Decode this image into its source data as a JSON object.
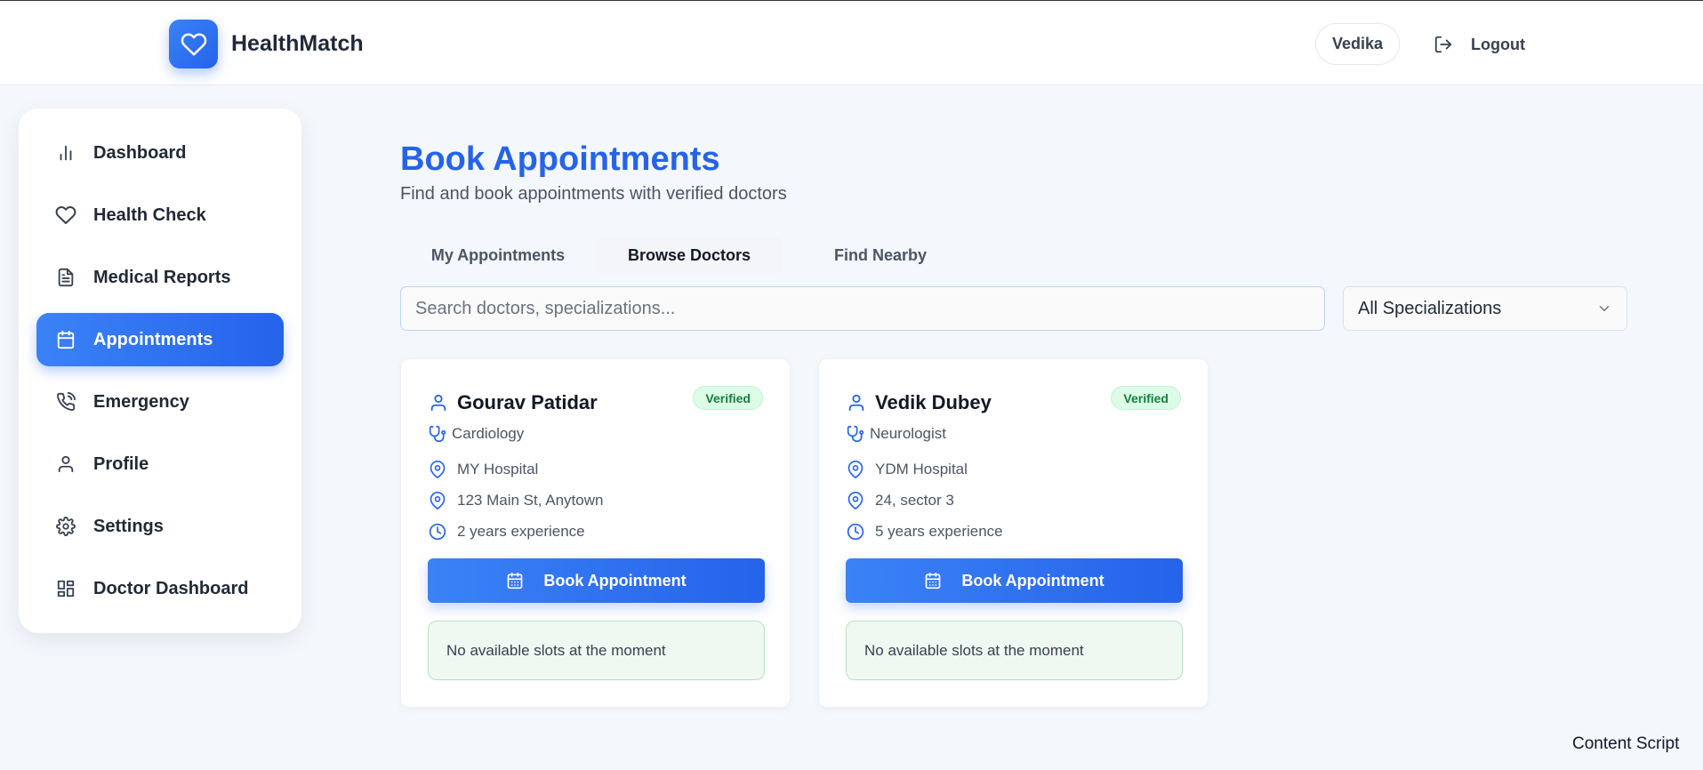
{
  "header": {
    "brand": "HealthMatch",
    "user_name": "Vedika",
    "logout_label": "Logout"
  },
  "sidebar": {
    "items": [
      {
        "label": "Dashboard",
        "icon": "bar-chart-icon"
      },
      {
        "label": "Health Check",
        "icon": "heart-icon"
      },
      {
        "label": "Medical Reports",
        "icon": "file-text-icon"
      },
      {
        "label": "Appointments",
        "icon": "calendar-icon",
        "active": true
      },
      {
        "label": "Emergency",
        "icon": "phone-call-icon"
      },
      {
        "label": "Profile",
        "icon": "user-icon"
      },
      {
        "label": "Settings",
        "icon": "gear-icon"
      },
      {
        "label": "Doctor Dashboard",
        "icon": "grid-icon"
      }
    ]
  },
  "main": {
    "title": "Book Appointments",
    "subtitle": "Find and book appointments with verified doctors",
    "tabs": [
      {
        "label": "My Appointments"
      },
      {
        "label": "Browse Doctors",
        "active": true
      },
      {
        "label": "Find Nearby"
      }
    ],
    "search": {
      "placeholder": "Search doctors, specializations...",
      "value": ""
    },
    "specialization_filter": {
      "selected": "All Specializations"
    },
    "doctors": [
      {
        "name": "Gourav Patidar",
        "badge": "Verified",
        "specialization": "Cardiology",
        "hospital": "MY Hospital",
        "address": "123 Main St, Anytown",
        "experience": "2 years experience",
        "book_label": "Book Appointment",
        "slots_message": "No available slots at the moment"
      },
      {
        "name": "Vedik Dubey",
        "badge": "Verified",
        "specialization": "Neurologist",
        "hospital": "YDM Hospital",
        "address": "24, sector 3",
        "experience": "5 years experience",
        "book_label": "Book Appointment",
        "slots_message": "No available slots at the moment"
      }
    ]
  },
  "footer": {
    "content_script_label": "Content Script"
  },
  "colors": {
    "primary": "#2563eb",
    "primary_light": "#3b82f6",
    "verified_bg": "#dcfce7",
    "verified_text": "#15803d",
    "slots_bg": "#f0f8f2"
  }
}
